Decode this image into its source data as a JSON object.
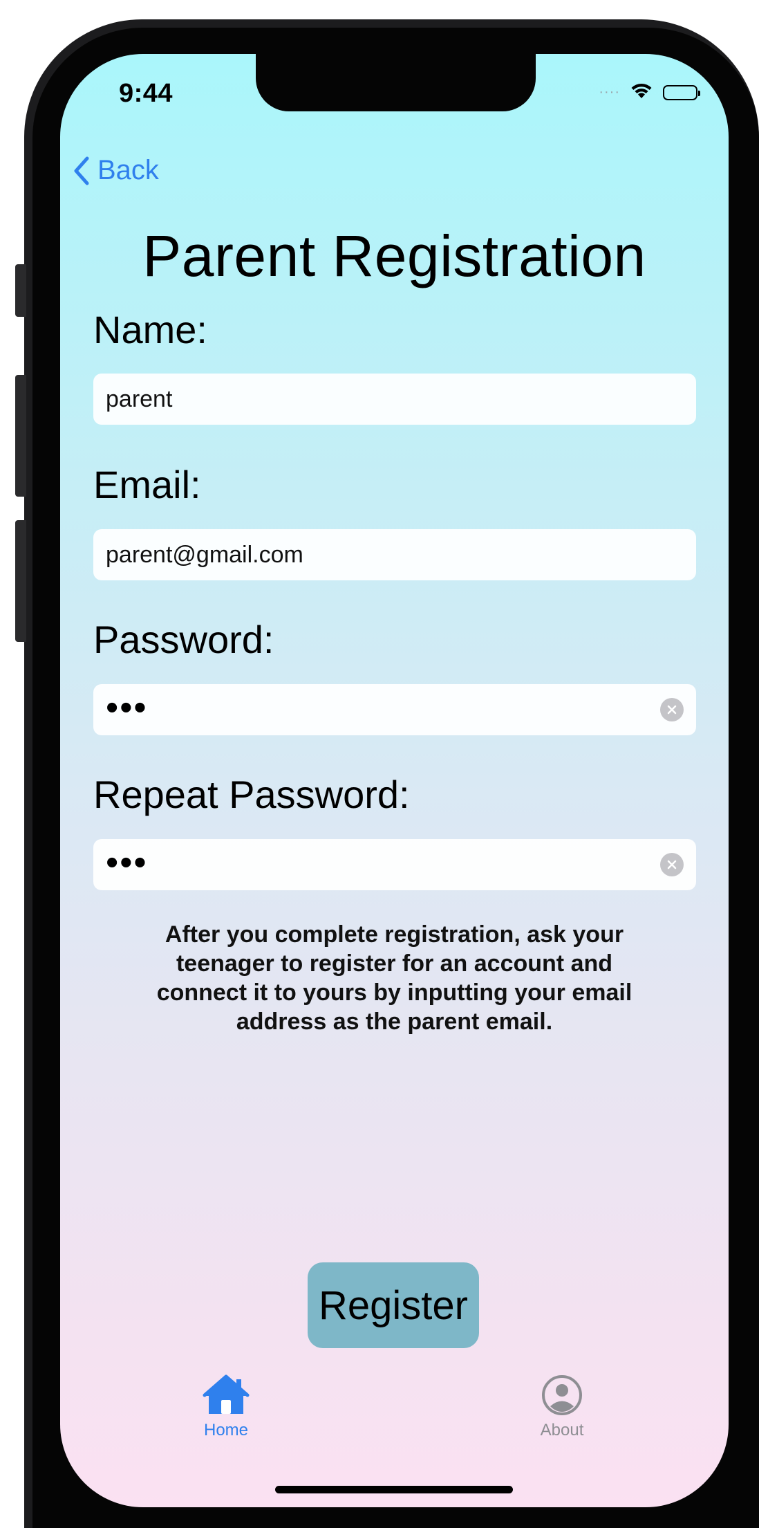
{
  "status_bar": {
    "time": "9:44",
    "signal": "····"
  },
  "nav": {
    "back_label": "Back"
  },
  "page": {
    "title": "Parent Registration"
  },
  "form": {
    "name_label": "Name:",
    "name_value": "parent",
    "email_label": "Email:",
    "email_value": "parent@gmail.com",
    "password_label": "Password:",
    "password_value": "•••",
    "repeat_password_label": "Repeat Password:",
    "repeat_password_value": "•••"
  },
  "info_text": "After you complete registration, ask your teenager to register for an account and connect it to yours by inputting your email address as the parent email.",
  "register_button": "Register",
  "tab_bar": {
    "items": [
      {
        "label": "Home",
        "icon": "house-icon",
        "active": true
      },
      {
        "label": "About",
        "icon": "person-circle-icon",
        "active": false
      }
    ]
  },
  "colors": {
    "accent": "#2f80ed",
    "button": "#7eb7c8",
    "inactive_tab": "#8e8e93"
  }
}
